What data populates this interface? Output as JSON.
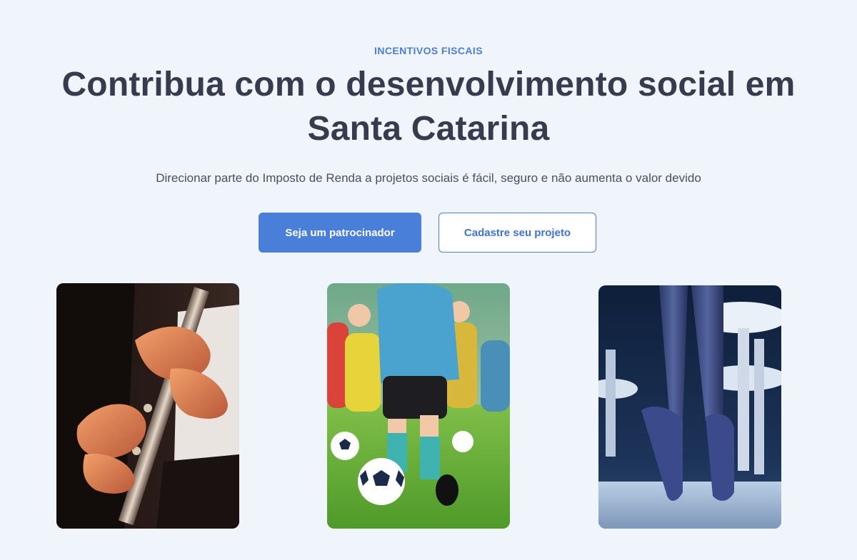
{
  "hero": {
    "eyebrow": "INCENTIVOS FISCAIS",
    "title": "Contribua com o desenvolvimento social em Santa Catarina",
    "subtitle": "Direcionar parte do Imposto de Renda a projetos sociais é fácil, seguro e não aumenta o valor devido",
    "primary_button": "Seja um patrocinador",
    "secondary_button": "Cadastre seu projeto"
  },
  "colors": {
    "background": "#f0f4fb",
    "accent": "#4a7fd9",
    "heading": "#363c4d"
  },
  "images": [
    {
      "name": "clarinet-photo",
      "subject": "music"
    },
    {
      "name": "soccer-photo",
      "subject": "sport"
    },
    {
      "name": "ballet-photo",
      "subject": "dance"
    }
  ]
}
